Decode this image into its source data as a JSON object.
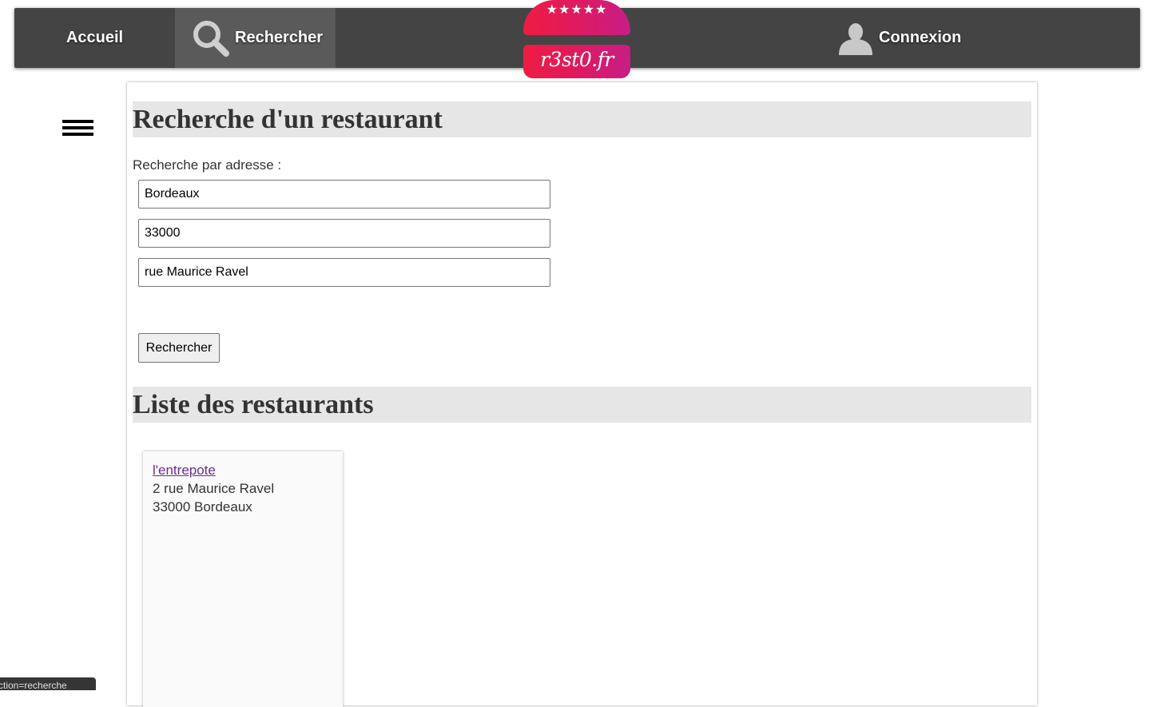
{
  "nav": {
    "home_label": "Accueil",
    "search_label": "Rechercher",
    "login_label": "Connexion",
    "search_icon": "magnifier-icon",
    "user_icon": "user-silhouette-icon"
  },
  "logo": {
    "stars": "★★★★★",
    "text": "r3st0.fr",
    "colors": [
      "#ee1c43",
      "#c71d86"
    ]
  },
  "menu_icon": "hamburger-icon",
  "search_section": {
    "title": "Recherche d'un restaurant",
    "address_label": "Recherche par adresse :",
    "city_value": "Bordeaux",
    "zip_value": "33000",
    "street_value": "rue Maurice Ravel",
    "submit_label": "Rechercher"
  },
  "list_section": {
    "title": "Liste des restaurants",
    "restaurants": [
      {
        "name": "l'entrepote",
        "street": "2 rue Maurice Ravel",
        "city_line": "33000 Bordeaux"
      }
    ]
  },
  "status_bar": {
    "text": "ction=recherche"
  },
  "colors": {
    "navbar": "#444444",
    "active_tab": "#5a5a5a",
    "section_header": "#e6e6e6",
    "visited_link": "#6b2c91"
  }
}
